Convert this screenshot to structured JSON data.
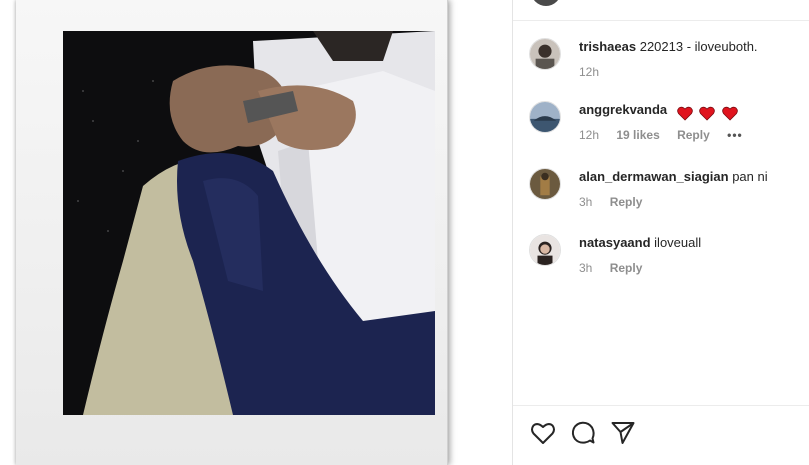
{
  "comments": [
    {
      "username": "trishaeas",
      "text": "220213 - iloveuboth.",
      "time": "12h"
    },
    {
      "username": "anggrekvanda",
      "text": "",
      "emoji": [
        "heart",
        "heart",
        "heart"
      ],
      "time": "12h",
      "likes": "19 likes",
      "reply": "Reply",
      "more": "•••"
    },
    {
      "username": "alan_dermawan_siagian",
      "text": "pan ni",
      "time": "3h",
      "reply": "Reply"
    },
    {
      "username": "natasyaand",
      "text": "iloveuall",
      "time": "3h",
      "reply": "Reply"
    }
  ],
  "actions": {
    "like_icon": "heart-outline-icon",
    "comment_icon": "comment-bubble-icon",
    "share_icon": "paper-plane-icon"
  },
  "colors": {
    "heart_emoji": "#e0141e",
    "meta_text": "#8e8e8e",
    "primary_text": "#262626"
  }
}
